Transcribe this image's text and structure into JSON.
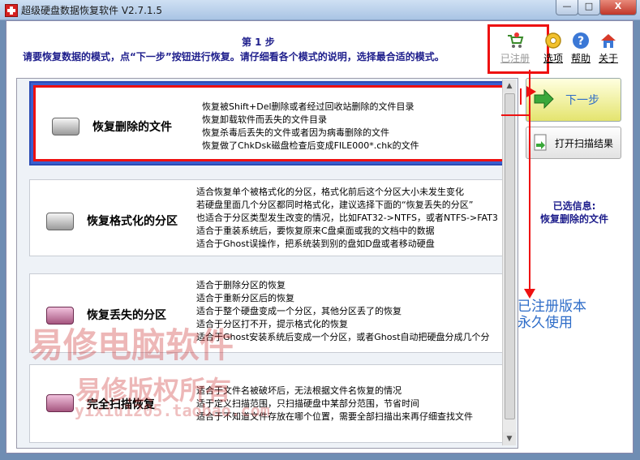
{
  "window": {
    "title": "超级硬盘数据恢复软件 V2.7.1.5",
    "minimize": "—",
    "maximize": "□",
    "close": "X"
  },
  "header": {
    "step": "第 1 步",
    "description": "请要恢复数据的模式，点“下一步”按钮进行恢复。请仔细看各个模式的说明，选择最合适的模式。"
  },
  "toolbar": {
    "registered": "已注册",
    "options": "选项",
    "help": "帮助",
    "close": "关于"
  },
  "modes": [
    {
      "name": "恢复删除的文件",
      "selected": true,
      "icon": "disk-icon",
      "desc": [
        "恢复被Shift+Del删除或者经过回收站删除的文件目录",
        "恢复卸载软件而丢失的文件目录",
        "恢复杀毒后丢失的文件或者因为病毒删除的文件",
        "恢复做了ChkDsk磁盘检查后变成FILE000*.chk的文件"
      ]
    },
    {
      "name": "恢复格式化的分区",
      "selected": false,
      "icon": "disk-icon",
      "desc": [
        "适合恢复单个被格式化的分区，格式化前后这个分区大小未发生变化",
        "若硬盘里面几个分区都同时格式化，建议选择下面的“恢复丢失的分区”",
        "也适合于分区类型发生改变的情况，比如FAT32->NTFS，或者NTFS->FAT3",
        "适合于重装系统后，要恢复原来C盘桌面或我的文档中的数据",
        "适合于Ghost误操作，把系统装到别的盘如D盘或者移动硬盘"
      ]
    },
    {
      "name": "恢复丢失的分区",
      "selected": false,
      "icon": "pink-disk-icon",
      "desc": [
        "适合于删除分区的恢复",
        "适合于重新分区后的恢复",
        "适合于整个硬盘变成一个分区，其他分区丢了的恢复",
        "适合于分区打不开，提示格式化的恢复",
        "适合于Ghost安装系统后变成一个分区，或者Ghost自动把硬盘分成几个分"
      ]
    },
    {
      "name": "完全扫描恢复",
      "selected": false,
      "icon": "pink-disk-icon",
      "desc": [
        "适合于文件名被破坏后，无法根据文件名恢复的情况",
        "适于定义扫描范围，只扫描硬盘中某部分范围，节省时间",
        "适合于不知道文件存放在哪个位置，需要全部扫描出来再仔细查找文件"
      ]
    }
  ],
  "buttons": {
    "next": "下一步",
    "open_scan": "打开扫描结果"
  },
  "selected_info": {
    "label": "已选信息:",
    "value": "恢复删除的文件"
  },
  "annotation": {
    "line1": "已注册版本",
    "line2": "永久使用"
  },
  "watermark": {
    "line1": "易修电脑软件",
    "line2": "易修版权所有",
    "line3": "yixiu1205.taobao.com"
  },
  "colors": {
    "accent_blue": "#1e1e8c",
    "highlight_red": "#ee1111",
    "selected_blue": "#3a5fd0"
  }
}
